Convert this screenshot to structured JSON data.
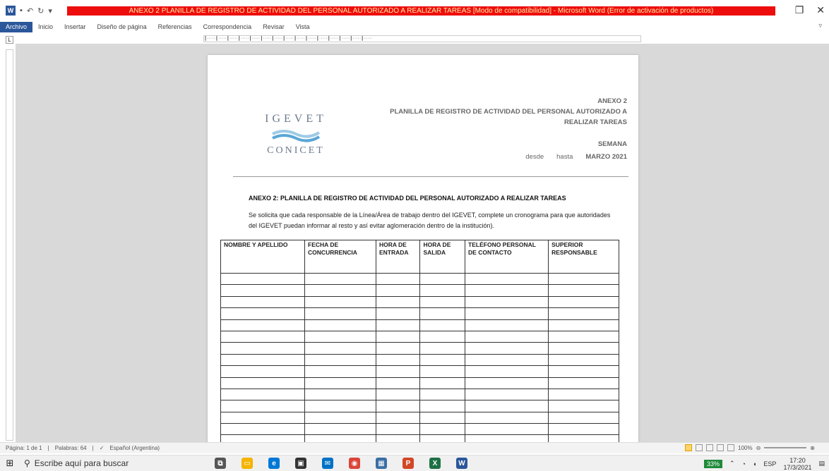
{
  "titlebar": {
    "title": "ANEXO 2 PLANILLA DE REGISTRO DE ACTIVIDAD DEL PERSONAL AUTORIZADO A REALIZAR TAREAS [Modo de compatibilidad] - Microsoft Word (Error de activación de productos)",
    "app_icon": "W",
    "accent": "#ee0d0d"
  },
  "ribbon": {
    "tabs": [
      "Archivo",
      "Inicio",
      "Insertar",
      "Diseño de página",
      "Referencias",
      "Correspondencia",
      "Revisar",
      "Vista"
    ]
  },
  "ruler": {
    "corner": "L"
  },
  "document": {
    "header": {
      "logo_top": "IGEVET",
      "logo_bottom": "CONICET",
      "annex": "ANEXO 2",
      "title_line1": "PLANILLA DE REGISTRO DE ACTIVIDAD DEL PERSONAL AUTORIZADO A",
      "title_line2": "REALIZAR TAREAS",
      "week": "SEMANA",
      "from": "desde",
      "to": "hasta",
      "month": "MARZO 2021"
    },
    "body_title": "ANEXO 2: PLANILLA DE REGISTRO DE ACTIVIDAD DEL PERSONAL AUTORIZADO A REALIZAR TAREAS",
    "paragraph": "Se solicita que cada responsable de la Línea/Área de trabajo dentro del IGEVET, complete un cronograma para que autoridades del IGEVET puedan informar al resto y así evitar aglomeración dentro de la institución).",
    "table": {
      "headers": [
        "NOMBRE Y APELLIDO",
        "FECHA DE CONCURRENCIA",
        "HORA DE ENTRADA",
        "HORA DE SALIDA",
        "TELÉFONO PERSONAL DE CONTACTO",
        "SUPERIOR RESPONSABLE"
      ]
    }
  },
  "statusbar": {
    "page": "Página: 1 de 1",
    "words": "Palabras: 64",
    "language": "Español (Argentina)",
    "zoom": "100%"
  },
  "taskbar": {
    "search_placeholder": "Escribe aquí para buscar",
    "battery": "33%",
    "lang": "ESP",
    "time": "17:20",
    "date": "17/3/2021"
  }
}
